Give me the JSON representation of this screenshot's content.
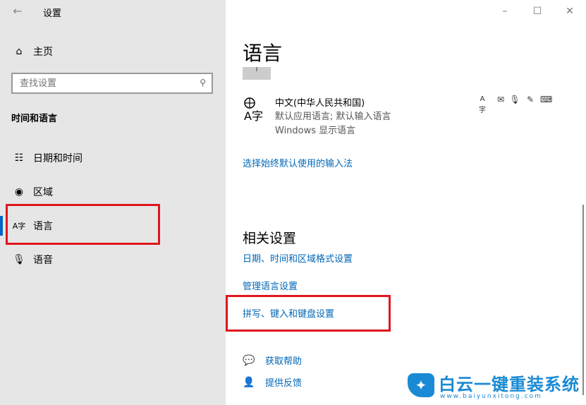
{
  "window": {
    "title": "设置",
    "back_icon": "back-arrow-icon"
  },
  "sidebar": {
    "home_label": "主页",
    "search_placeholder": "查找设置",
    "section": "时间和语言",
    "items": [
      {
        "label": "日期和时间",
        "icon": "calendar-clock-icon"
      },
      {
        "label": "区域",
        "icon": "globe-icon"
      },
      {
        "label": "语言",
        "icon": "language-icon",
        "selected": true
      },
      {
        "label": "语音",
        "icon": "microphone-icon"
      }
    ]
  },
  "main": {
    "title": "语言",
    "language": {
      "name": "中文(中华人民共和国)",
      "sub1": "默认应用语言; 默认输入语言",
      "sub2": "Windows 显示语言",
      "icon_text": "A字"
    },
    "input_link": "选择始终默认使用的输入法",
    "related": {
      "title": "相关设置",
      "links": [
        "日期、时间和区域格式设置",
        "管理语言设置",
        "拼写、键入和键盘设置"
      ]
    },
    "help": [
      {
        "label": "获取帮助",
        "icon": "help-chat-icon"
      },
      {
        "label": "提供反馈",
        "icon": "feedback-icon"
      }
    ]
  },
  "watermark": {
    "text": "白云一键重装系统",
    "url": "www.baiyunxitong.com"
  },
  "colors": {
    "accent": "#0067b8",
    "highlight": "#e0161e",
    "sidebar_bg": "#e6e6e6"
  }
}
